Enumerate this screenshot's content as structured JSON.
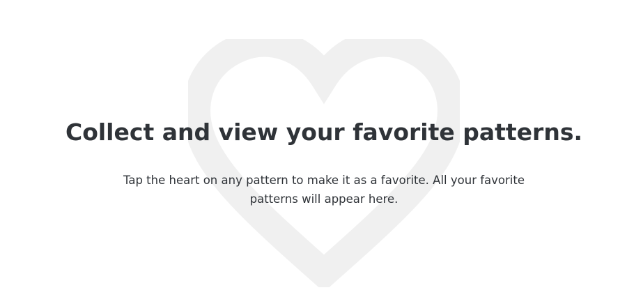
{
  "empty_state": {
    "icon": "heart-outline-icon",
    "icon_color": "#f0f0f0",
    "text_color": "#2f3338",
    "headline": "Collect and view your favorite patterns.",
    "description": "Tap the heart on any pattern to make it as a favorite. All your favorite patterns will appear here."
  }
}
